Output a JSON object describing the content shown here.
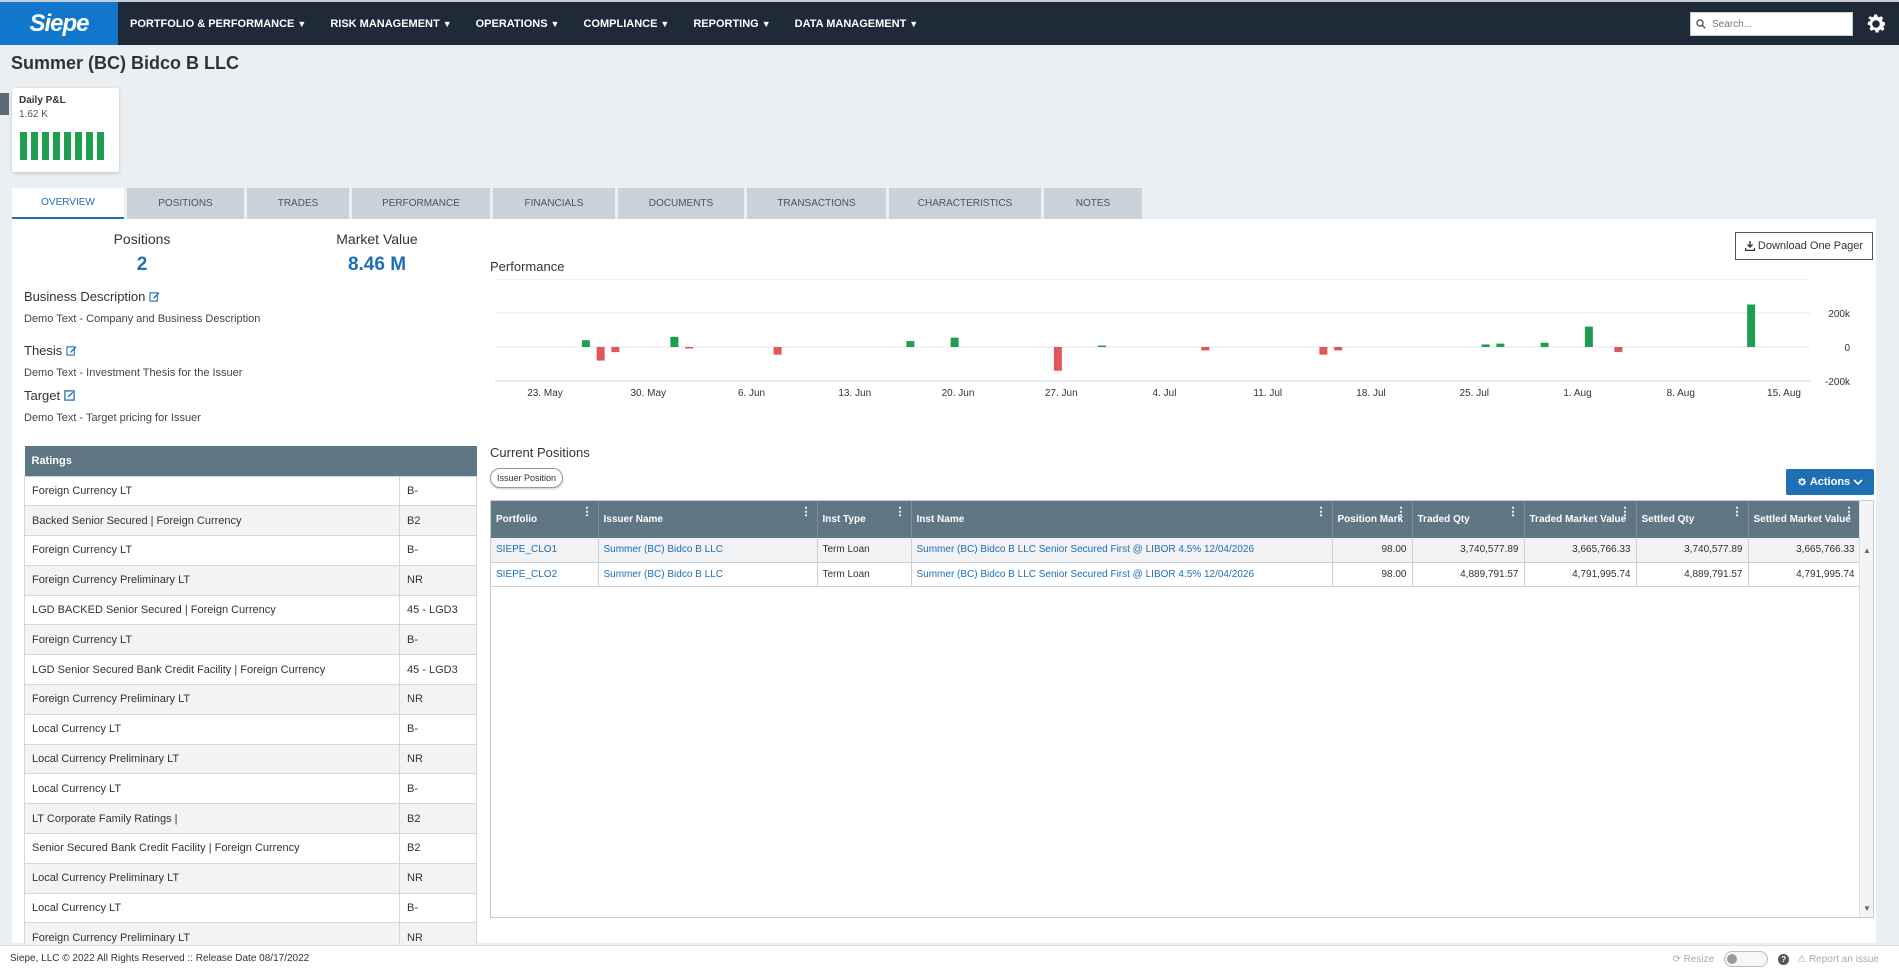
{
  "app": {
    "logo": "Siepe"
  },
  "nav": {
    "items": [
      {
        "label": "PORTFOLIO & PERFORMANCE"
      },
      {
        "label": "RISK MANAGEMENT"
      },
      {
        "label": "OPERATIONS"
      },
      {
        "label": "COMPLIANCE"
      },
      {
        "label": "REPORTING"
      },
      {
        "label": "DATA MANAGEMENT"
      }
    ],
    "search_placeholder": "Search..."
  },
  "page": {
    "title": "Summer (BC) Bidco B LLC"
  },
  "pnl_card": {
    "title": "Daily P&L",
    "value": "1.62 K",
    "bars": 8
  },
  "tabs": [
    {
      "label": "OVERVIEW",
      "active": true
    },
    {
      "label": "POSITIONS"
    },
    {
      "label": "TRADES"
    },
    {
      "label": "PERFORMANCE"
    },
    {
      "label": "FINANCIALS"
    },
    {
      "label": "DOCUMENTS"
    },
    {
      "label": "TRANSACTIONS"
    },
    {
      "label": "CHARACTERISTICS"
    },
    {
      "label": "NOTES"
    }
  ],
  "overview": {
    "positions_label": "Positions",
    "positions_value": "2",
    "market_value_label": "Market Value",
    "market_value_value": "8.46 M",
    "business_description": {
      "label": "Business Description",
      "text": "Demo Text - Company and Business Description"
    },
    "thesis": {
      "label": "Thesis",
      "text": "Demo Text - Investment Thesis for the Issuer"
    },
    "target": {
      "label": "Target",
      "text": "Demo Text - Target pricing for Issuer"
    }
  },
  "ratings": {
    "header": "Ratings",
    "rows": [
      {
        "name": "Foreign Currency LT",
        "value": "B-"
      },
      {
        "name": "Backed Senior Secured | Foreign Currency",
        "value": "B2"
      },
      {
        "name": "Foreign Currency LT",
        "value": "B-"
      },
      {
        "name": "Foreign Currency Preliminary LT",
        "value": "NR"
      },
      {
        "name": "LGD BACKED Senior Secured | Foreign Currency",
        "value": "45 - LGD3"
      },
      {
        "name": "Foreign Currency LT",
        "value": "B-"
      },
      {
        "name": "LGD Senior Secured Bank Credit Facility | Foreign Currency",
        "value": "45 - LGD3"
      },
      {
        "name": "Foreign Currency Preliminary LT",
        "value": "NR"
      },
      {
        "name": "Local Currency LT",
        "value": "B-"
      },
      {
        "name": "Local Currency Preliminary LT",
        "value": "NR"
      },
      {
        "name": "Local Currency LT",
        "value": "B-"
      },
      {
        "name": "LT Corporate Family Ratings |",
        "value": "B2"
      },
      {
        "name": "Senior Secured Bank Credit Facility | Foreign Currency",
        "value": "B2"
      },
      {
        "name": "Local Currency Preliminary LT",
        "value": "NR"
      },
      {
        "name": "Local Currency LT",
        "value": "B-"
      },
      {
        "name": "Foreign Currency Preliminary LT",
        "value": "NR"
      }
    ]
  },
  "performance": {
    "title": "Performance",
    "download_label": "Download One Pager"
  },
  "chart_data": {
    "type": "bar",
    "title": "Performance",
    "x_ticks": [
      "23. May",
      "30. May",
      "6. Jun",
      "13. Jun",
      "20. Jun",
      "27. Jun",
      "4. Jul",
      "11. Jul",
      "18. Jul",
      "25. Jul",
      "1. Aug",
      "8. Aug",
      "15. Aug"
    ],
    "y_ticks": [
      "200k",
      "0",
      "-200k"
    ],
    "ylim": [
      -200000,
      200000
    ],
    "bars": [
      {
        "day": 3,
        "value": 40000
      },
      {
        "day": 4,
        "value": -80000
      },
      {
        "day": 5,
        "value": -30000
      },
      {
        "day": 9,
        "value": 60000
      },
      {
        "day": 10,
        "value": -5000
      },
      {
        "day": 16,
        "value": -45000
      },
      {
        "day": 25,
        "value": 35000
      },
      {
        "day": 28,
        "value": 55000
      },
      {
        "day": 35,
        "value": -140000
      },
      {
        "day": 38,
        "value": 5000
      },
      {
        "day": 45,
        "value": -20000
      },
      {
        "day": 53,
        "value": -45000
      },
      {
        "day": 54,
        "value": -20000
      },
      {
        "day": 64,
        "value": 15000
      },
      {
        "day": 65,
        "value": 20000
      },
      {
        "day": 68,
        "value": 25000
      },
      {
        "day": 71,
        "value": 120000
      },
      {
        "day": 73,
        "value": -30000
      },
      {
        "day": 82,
        "value": 250000
      }
    ],
    "colors": {
      "positive": "#1e9e4e",
      "negative": "#e05757"
    },
    "grid": true
  },
  "positions": {
    "title": "Current Positions",
    "issuer_button": "Issuer Position",
    "actions_label": "Actions",
    "columns": [
      "Portfolio",
      "Issuer Name",
      "Inst Type",
      "Inst Name",
      "Position Mark",
      "Traded Qty",
      "Traded Market Value",
      "Settled Qty",
      "Settled Market Value"
    ],
    "rows": [
      {
        "portfolio": "SIEPE_CLO1",
        "issuer": "Summer (BC) Bidco B LLC",
        "inst_type": "Term Loan",
        "inst_name": "Summer (BC) Bidco B LLC Senior Secured First @ LIBOR 4.5% 12/04/2026",
        "mark": "98.00",
        "traded_qty": "3,740,577.89",
        "traded_mv": "3,665,766.33",
        "settled_qty": "3,740,577.89",
        "settled_mv": "3,665,766.33"
      },
      {
        "portfolio": "SIEPE_CLO2",
        "issuer": "Summer (BC) Bidco B LLC",
        "inst_type": "Term Loan",
        "inst_name": "Summer (BC) Bidco B LLC Senior Secured First @ LIBOR 4.5% 12/04/2026",
        "mark": "98.00",
        "traded_qty": "4,889,791.57",
        "traded_mv": "4,791,995.74",
        "settled_qty": "4,889,791.57",
        "settled_mv": "4,791,995.74"
      }
    ]
  },
  "footer": {
    "text": "Siepe, LLC © 2022 All Rights Reserved :: Release Date 08/17/2022",
    "resize_label": "Resize",
    "report_label": "Report an issue"
  }
}
